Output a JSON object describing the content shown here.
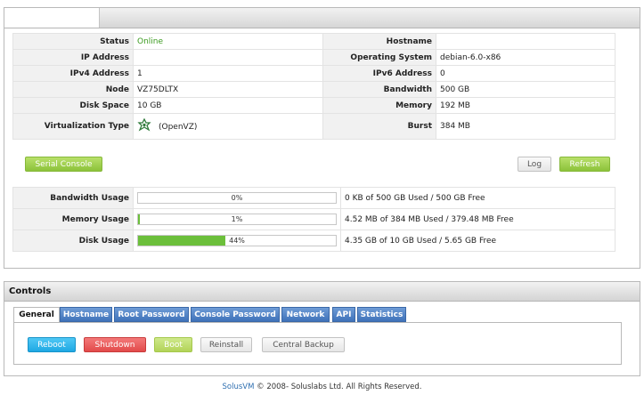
{
  "info": {
    "status_label": "Status",
    "status_value": "Online",
    "hostname_label": "Hostname",
    "hostname_value": "",
    "ip_label": "IP Address",
    "ip_value": "",
    "os_label": "Operating System",
    "os_value": "debian-6.0-x86",
    "ipv4_label": "IPv4 Address",
    "ipv4_value": "1",
    "ipv6_label": "IPv6 Address",
    "ipv6_value": "0",
    "node_label": "Node",
    "node_value": "VZ75DLTX",
    "bandwidth_label": "Bandwidth",
    "bandwidth_value": "500 GB",
    "disk_label": "Disk Space",
    "disk_value": "10 GB",
    "memory_label": "Memory",
    "memory_value": "192 MB",
    "virt_label": "Virtualization Type",
    "virt_value": "(OpenVZ)",
    "burst_label": "Burst",
    "burst_value": "384 MB",
    "status_color": "#3a9a1e"
  },
  "buttons": {
    "serial_console": "Serial Console",
    "log": "Log",
    "refresh": "Refresh"
  },
  "usage": [
    {
      "label": "Bandwidth Usage",
      "percent_text": "0%",
      "percent": 0,
      "detail": "0 KB of 500 GB Used / 500 GB Free"
    },
    {
      "label": "Memory Usage",
      "percent_text": "1%",
      "percent": 1,
      "detail": "4.52 MB of 384 MB Used / 379.48 MB Free"
    },
    {
      "label": "Disk Usage",
      "percent_text": "44%",
      "percent": 44,
      "detail": "4.35 GB of 10 GB Used / 5.65 GB Free"
    }
  ],
  "controls": {
    "title": "Controls",
    "tabs": [
      "General",
      "Hostname",
      "Root Password",
      "Console Password",
      "Network",
      "API",
      "Statistics"
    ],
    "actions": [
      "Reboot",
      "Shutdown",
      "Boot",
      "Reinstall",
      "Central Backup"
    ]
  },
  "footer": {
    "brand": "SolusVM",
    "text": " © 2008- Soluslabs Ltd. All Rights Reserved."
  },
  "colors": {
    "bar_fill": "#6cbf3b",
    "tab_blue": "#3f72b9",
    "reboot": "#1fa8e3",
    "shutdown": "#e24a4a",
    "boot": "#b2d358"
  },
  "icons": {
    "virtualization": "openvz-logo-icon"
  }
}
